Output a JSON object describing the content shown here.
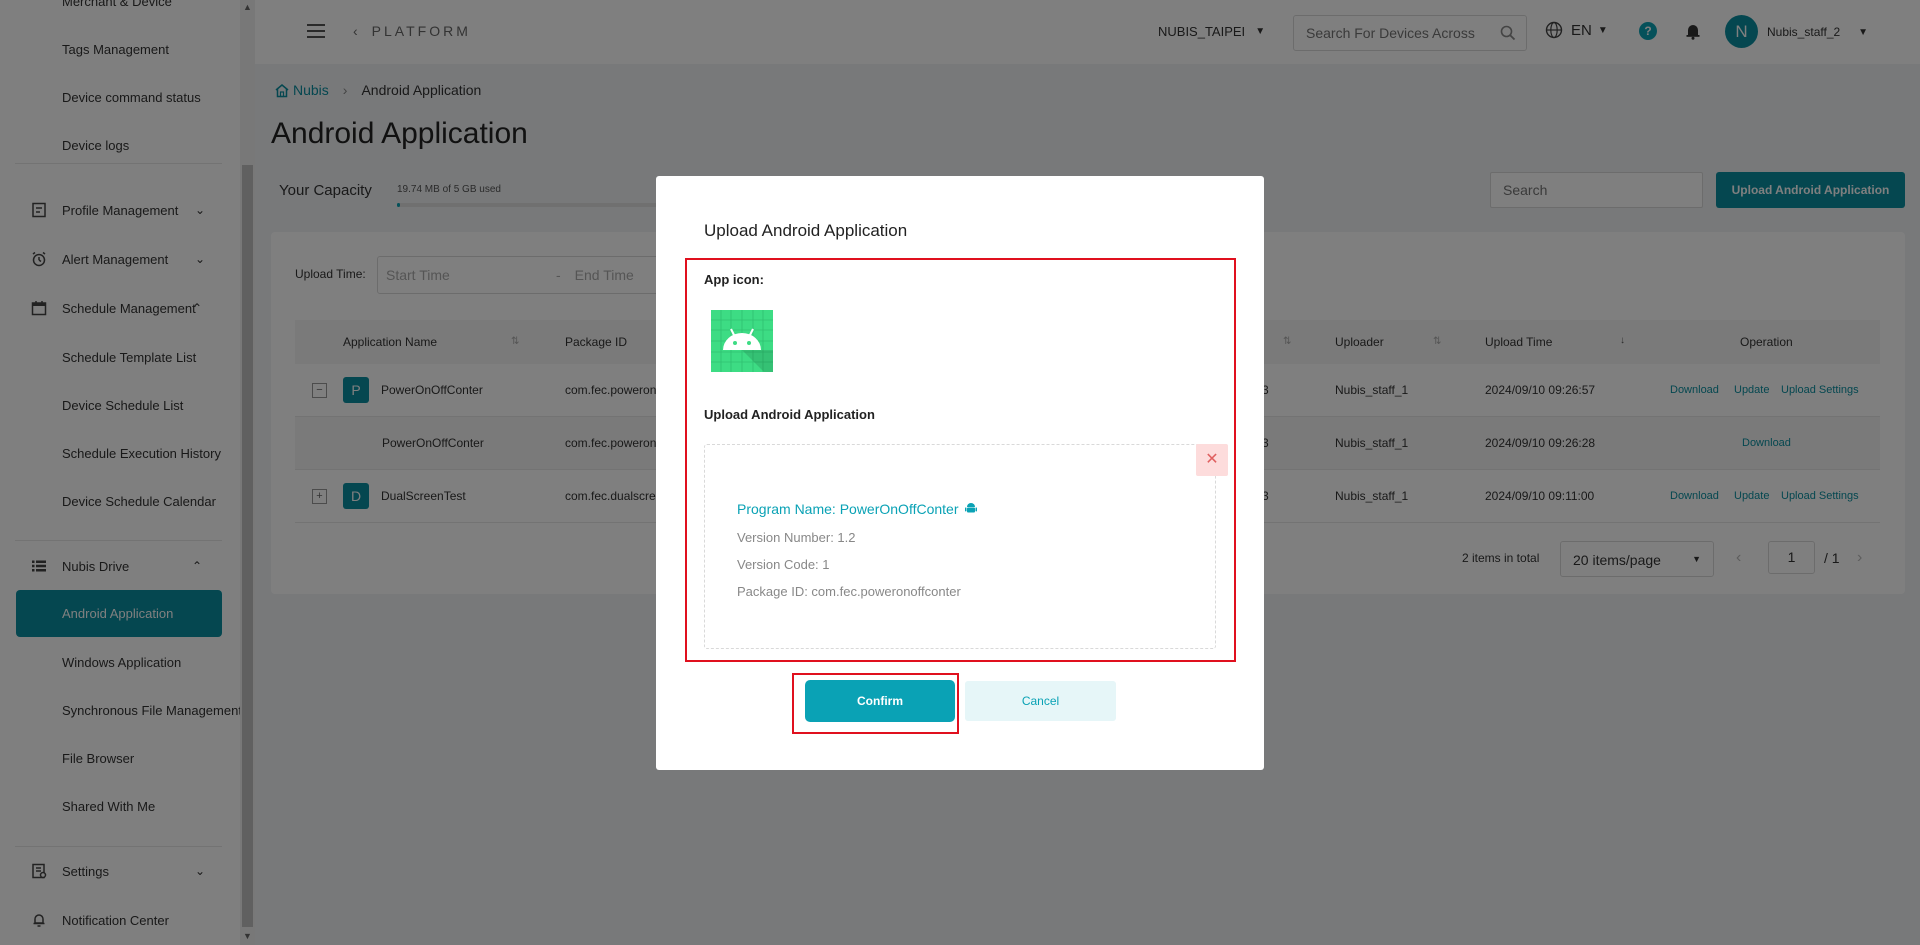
{
  "sidebar": {
    "partial_top": "Merchant & Device",
    "sub_device": [
      "Tags Management",
      "Device command status",
      "Device logs"
    ],
    "groups": {
      "profile": "Profile Management",
      "alert": "Alert Management",
      "schedule": "Schedule Management",
      "drive": "Nubis Drive",
      "settings": "Settings",
      "notification": "Notification Center"
    },
    "sub_schedule": [
      "Schedule Template List",
      "Device Schedule List",
      "Schedule Execution History",
      "Device Schedule Calendar"
    ],
    "sub_drive": [
      "Android Application",
      "Windows Application",
      "Synchronous File Management",
      "File Browser",
      "Shared With Me"
    ]
  },
  "header": {
    "platform": "PLATFORM",
    "org": "NUBIS_TAIPEI",
    "search_placeholder": "Search For Devices Across",
    "lang": "EN",
    "avatar_letter": "N",
    "user": "Nubis_staff_2"
  },
  "breadcrumb": {
    "home": "Nubis",
    "current": "Android Application"
  },
  "page_title": "Android Application",
  "capacity": {
    "label": "Your Capacity",
    "value": "19.74 MB of 5 GB used",
    "fraction": 0.004
  },
  "search_placeholder": "Search",
  "upload_button": "Upload Android Application",
  "filter": {
    "label": "Upload Time:",
    "start": "Start Time",
    "dash": "-",
    "end": "End Time"
  },
  "table": {
    "headers": {
      "name": "Application Name",
      "package": "Package ID",
      "uploader": "Uploader",
      "upload_time": "Upload Time",
      "operation": "Operation"
    },
    "rows": [
      {
        "expander": "−",
        "letter": "P",
        "name": "PowerOnOffConter",
        "package": "com.fec.poweron",
        "size_tail": "3",
        "uploader": "Nubis_staff_1",
        "time": "2024/09/10 09:26:57",
        "ops": [
          "Download",
          "Update",
          "Upload Settings"
        ]
      },
      {
        "name": "PowerOnOffConter",
        "package": "com.fec.poweron",
        "size_tail": "3",
        "uploader": "Nubis_staff_1",
        "time": "2024/09/10 09:26:28",
        "ops": [
          "Download"
        ]
      },
      {
        "expander": "+",
        "letter": "D",
        "name": "DualScreenTest",
        "package": "com.fec.dualscre",
        "size_tail": "3",
        "uploader": "Nubis_staff_1",
        "time": "2024/09/10 09:11:00",
        "ops": [
          "Download",
          "Update",
          "Upload Settings"
        ]
      }
    ]
  },
  "pagination": {
    "info": "2 items in total",
    "page_size": "20 items/page",
    "page": "1",
    "total": "/ 1"
  },
  "modal": {
    "title": "Upload Android Application",
    "app_icon_label": "App icon:",
    "upload_label": "Upload Android Application",
    "program_name": "Program Name: PowerOnOffConter",
    "version_number": "Version Number: 1.2",
    "version_code": "Version Code: 1",
    "package_id": "Package ID: com.fec.poweronoffconter",
    "confirm": "Confirm",
    "cancel": "Cancel"
  },
  "colors": {
    "accent": "#0a8fa0",
    "highlight": "#e0101e",
    "android_green": "#3ddc84"
  }
}
